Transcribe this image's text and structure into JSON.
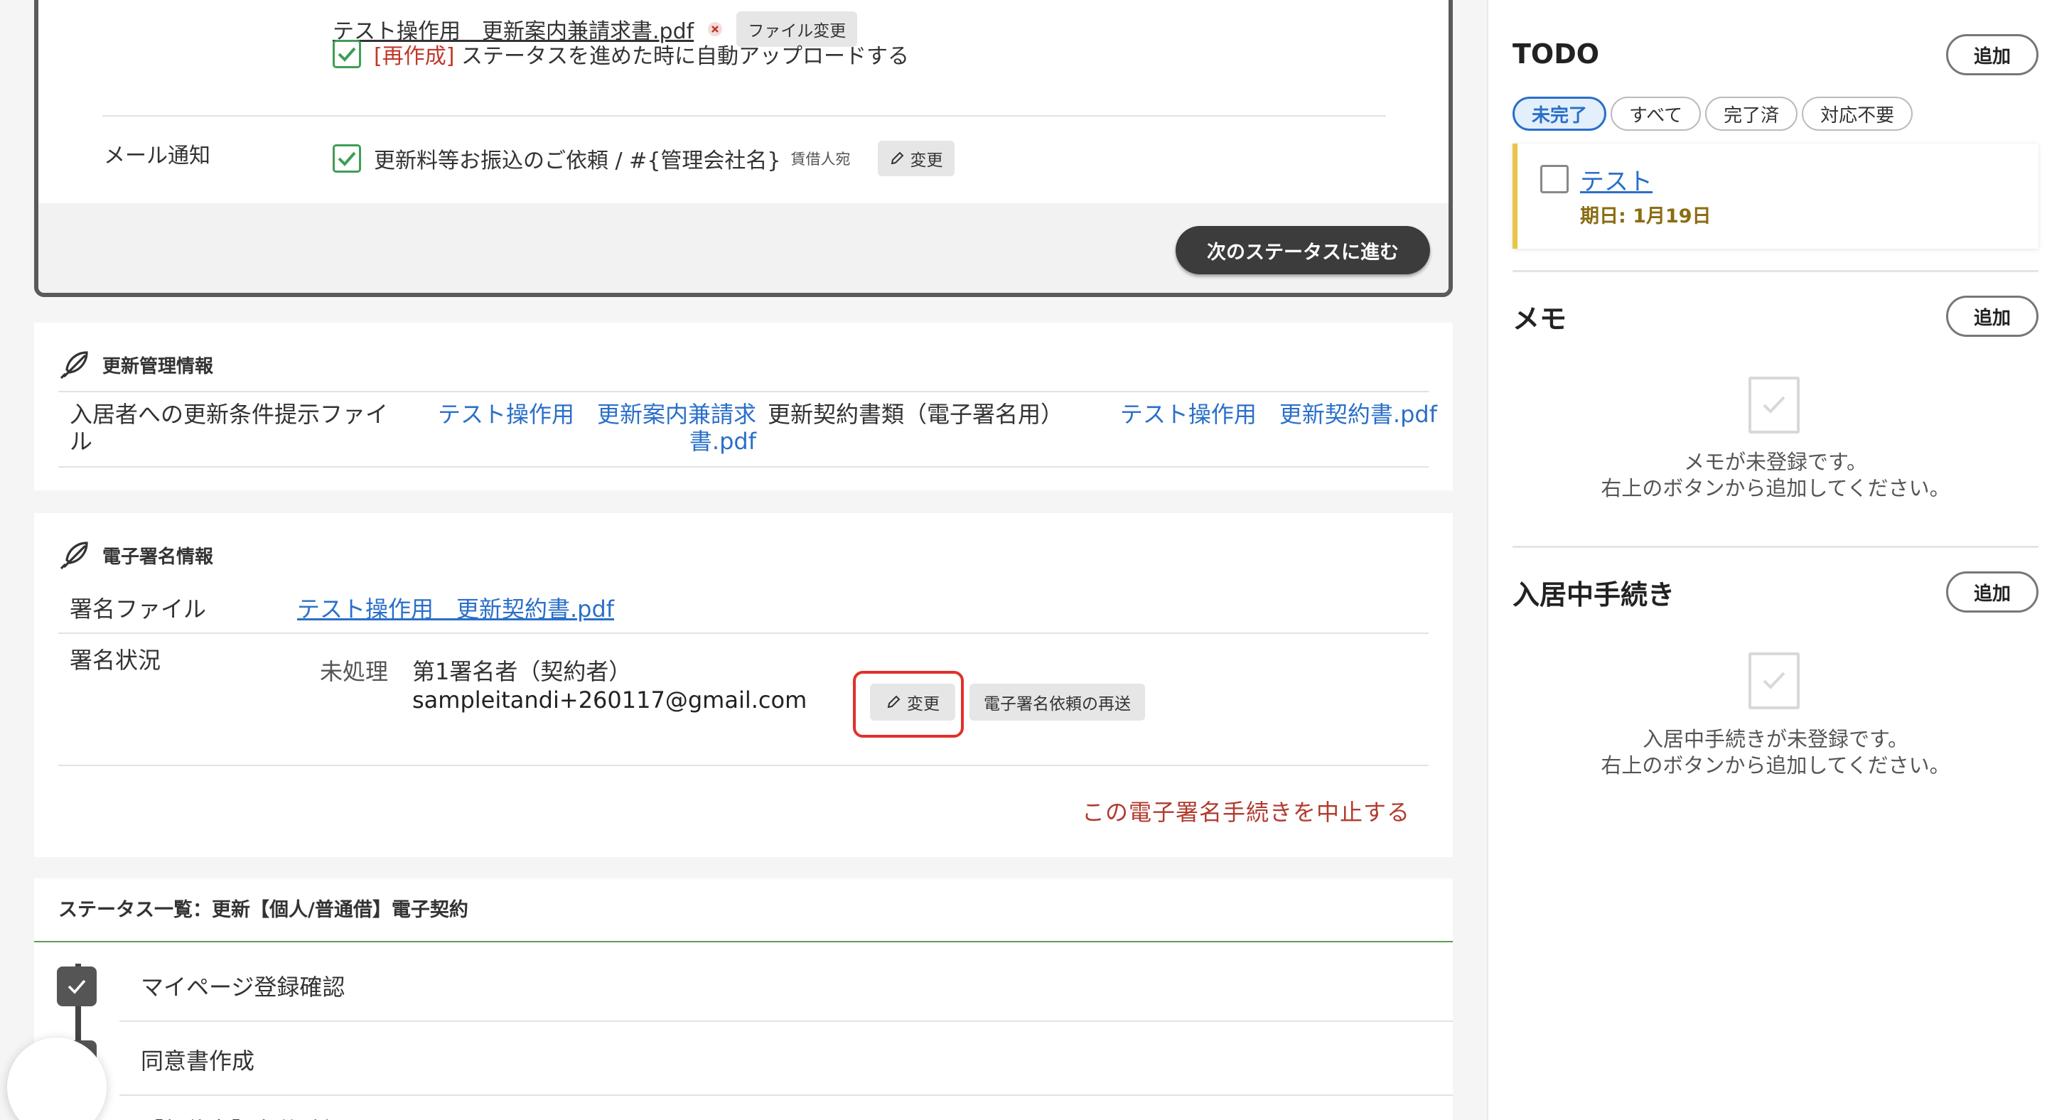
{
  "status_card": {
    "attachment_name": "テスト操作用　更新案内兼請求書.pdf",
    "file_change_label": "ファイル変更",
    "regenerate_tag": "[再作成]",
    "regenerate_text": "ステータスを進めた時に自動アップロードする",
    "mail_label": "メール通知",
    "mail_template": "更新料等お振込のご依頼 / #{管理会社名}",
    "mail_recipient": "賃借人宛",
    "mail_change_label": "変更",
    "next_status_label": "次のステータスに進む"
  },
  "renewal_info": {
    "title": "更新管理情報",
    "row1_label": "入居者への更新条件提示ファイル",
    "row1_value": "テスト操作用　更新案内兼請求書.pdf",
    "row2_label": "更新契約書類（電子署名用）",
    "row2_value": "テスト操作用　更新契約書.pdf"
  },
  "esign_info": {
    "title": "電子署名情報",
    "file_label": "署名ファイル",
    "file_value": "テスト操作用　更新契約書.pdf",
    "status_label": "署名状況",
    "state": "未処理",
    "signer_role": "第1署名者（契約者）",
    "signer_email": "sampleitandi+260117@gmail.com",
    "change_label": "変更",
    "resend_label": "電子署名依頼の再送",
    "cancel_label": "この電子署名手続きを中止する"
  },
  "status_list": {
    "title": "ステータス一覧：更新【個人/普通借】電子契約",
    "steps": [
      {
        "label": "マイページ登録確認"
      },
      {
        "label": "同意書作成"
      },
      {
        "label": "【契約者】条件確認"
      }
    ]
  },
  "sidebar": {
    "todo": {
      "title": "TODO",
      "add_label": "追加",
      "filters": [
        "未完了",
        "すべて",
        "完了済",
        "対応不要"
      ],
      "active_filter": "未完了",
      "items": [
        {
          "title": "テスト",
          "due": "期日: 1月19日"
        }
      ]
    },
    "memo": {
      "title": "メモ",
      "add_label": "追加",
      "empty_line1": "メモが未登録です。",
      "empty_line2": "右上のボタンから追加してください。"
    },
    "procedures": {
      "title": "入居中手続き",
      "add_label": "追加",
      "empty_line1": "入居中手続きが未登録です。",
      "empty_line2": "右上のボタンから追加してください。"
    }
  },
  "colors": {
    "link": "#2a6fc9",
    "check_green": "#3f9e55",
    "danger_red": "#b23a2e",
    "highlight_red": "#e0312b",
    "todo_yellow": "#e9c547"
  }
}
